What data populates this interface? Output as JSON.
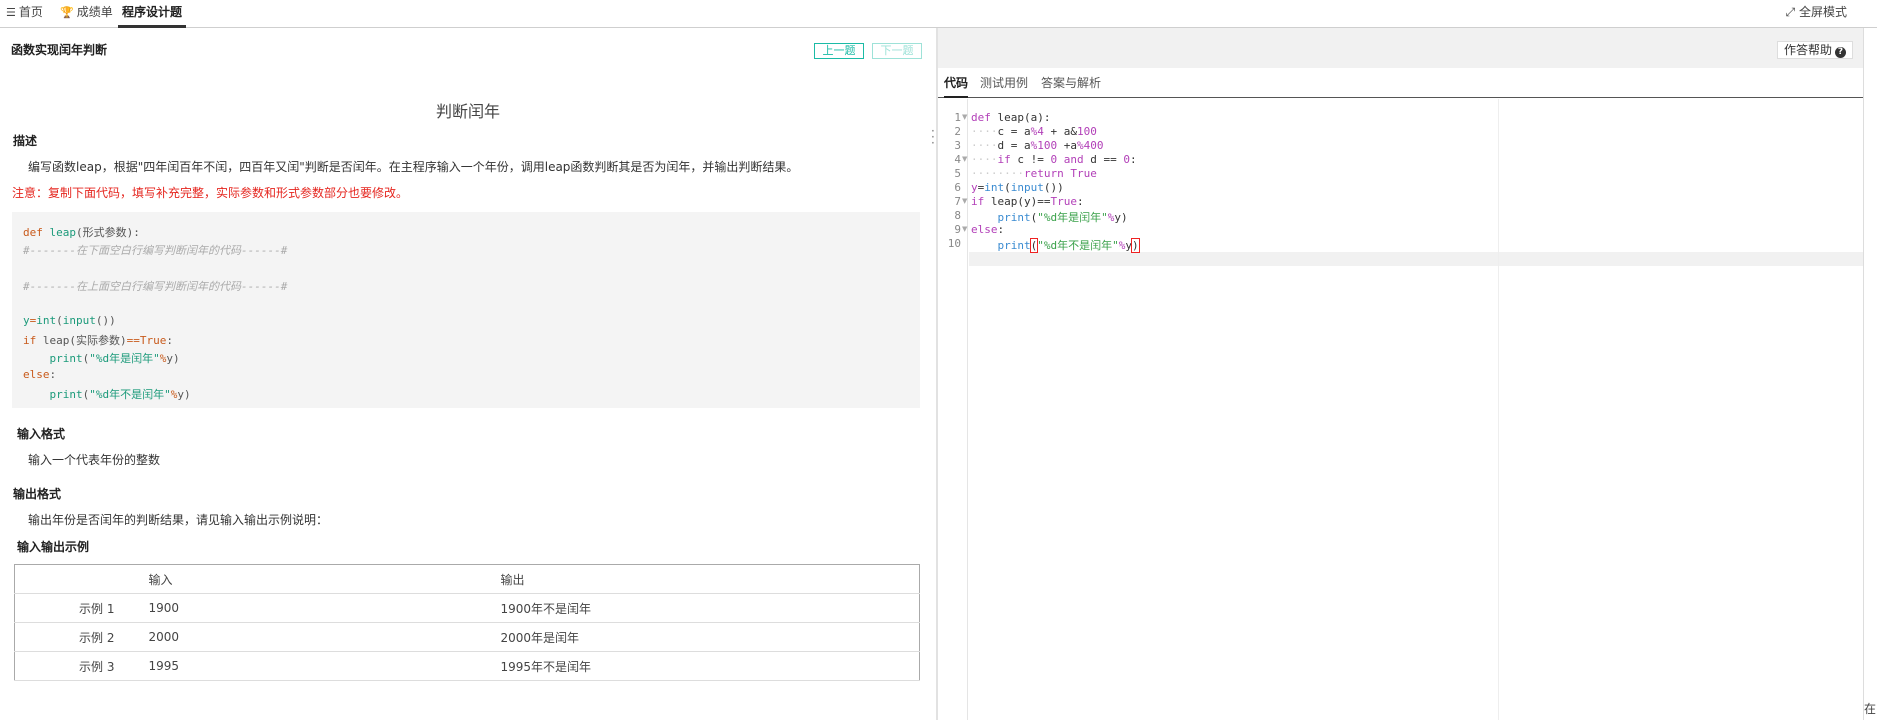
{
  "topbar": {
    "tabs": [
      {
        "icon": "list-icon",
        "label": "首页"
      },
      {
        "icon": "trophy-icon",
        "label": "成绩单"
      },
      {
        "icon": "",
        "label": "程序设计题"
      }
    ],
    "fullscreen": "全屏模式"
  },
  "problem": {
    "header_title": "函数实现闰年判断",
    "prev": "上一题",
    "next": "下一题",
    "title": "判断闰年",
    "desc_heading": "描述",
    "desc_text": "编写函数leap，根据\"四年闰百年不闰，四百年又闰\"判断是否闰年。在主程序输入一个年份，调用leap函数判断其是否为闰年，并输出判断结果。",
    "warning": "注意：复制下面代码，填写补充完整，实际参数和形式参数部分也要修改。",
    "code": [
      "def leap(形式参数):",
      "#-------在下面空白行编写判断闰年的代码------#",
      "",
      "#-------在上面空白行编写判断闰年的代码------#",
      "",
      "y=int(input())",
      "if leap(实际参数)==True:",
      "    print(\"%d年是闰年\"%y)",
      "else:",
      "    print(\"%d年不是闰年\"%y)"
    ],
    "input_heading": "输入格式",
    "input_text": "输入一个代表年份的整数",
    "output_heading": "输出格式",
    "output_text": "输出年份是否闰年的判断结果，请见输入输出示例说明：",
    "examples_heading": "输入输出示例",
    "examples_table": {
      "headers": [
        "",
        "输入",
        "输出"
      ],
      "rows": [
        [
          "示例 1",
          "1900",
          "1900年不是闰年"
        ],
        [
          "示例 2",
          "2000",
          "2000年是闰年"
        ],
        [
          "示例 3",
          "1995",
          "1995年不是闰年"
        ]
      ]
    }
  },
  "right": {
    "help": "作答帮助",
    "tabs": [
      "代码",
      "测试用例",
      "答案与解析"
    ],
    "line_numbers": [
      "1",
      "2",
      "3",
      "4",
      "5",
      "6",
      "7",
      "8",
      "9",
      "10"
    ],
    "editor_lines": [
      "def leap(a):",
      "    c = a%4 + a&100",
      "    d = a%100 +a%400",
      "    if c != 0 and d == 0:",
      "        return True",
      "y=int(input())",
      "if leap(y)==True:",
      "    print(\"%d年是闰年\"%y)",
      "else:",
      "    print(\"%d年不是闰年\"%y)"
    ],
    "corner_char": "在"
  },
  "colors": {
    "accent": "#1bbba6",
    "warning": "#e5261f",
    "keyword": "#b23fb8",
    "builtin": "#3a8bd1",
    "string": "#3aa14a"
  }
}
